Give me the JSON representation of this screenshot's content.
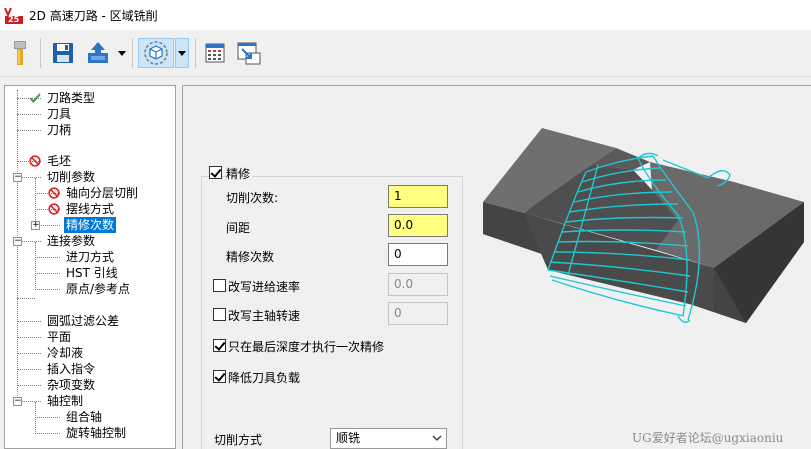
{
  "window": {
    "title": "2D 高速刀路 - 区域铣削",
    "logo_text": "25",
    "colors": {
      "logo_red": "#cc1f1f",
      "selection_blue": "#0078d7",
      "highlight_yellow": "#ffff80",
      "toolpath_cyan": "#1ec8d2"
    }
  },
  "toolbar": {
    "buttons": [
      {
        "name": "tool-icon"
      },
      {
        "name": "save-icon"
      },
      {
        "name": "export-icon"
      },
      {
        "name": "view-cube-icon",
        "active": true
      },
      {
        "name": "calculator-icon"
      },
      {
        "name": "minimize-to-graphics-icon"
      }
    ]
  },
  "tree": {
    "items": [
      {
        "label": "刀路类型",
        "mark": "check"
      },
      {
        "label": "刀具"
      },
      {
        "label": "刀柄"
      },
      {
        "label": "毛坯",
        "mark": "forbidden"
      },
      {
        "label": "切削参数",
        "expander": "−"
      },
      {
        "label": "轴向分层切削",
        "mark": "forbidden"
      },
      {
        "label": "摆线方式",
        "mark": "forbidden"
      },
      {
        "label": "精修次数",
        "expander": "+",
        "selected": true
      },
      {
        "label": "连接参数",
        "expander": "−"
      },
      {
        "label": "进刀方式"
      },
      {
        "label": "HST 引线"
      },
      {
        "label": "原点/参考点"
      },
      {
        "label": "圆弧过滤公差"
      },
      {
        "label": "平面"
      },
      {
        "label": "冷却液"
      },
      {
        "label": "插入指令"
      },
      {
        "label": "杂项变数"
      },
      {
        "label": "轴控制",
        "expander": "−"
      },
      {
        "label": "组合轴"
      },
      {
        "label": "旋转轴控制"
      }
    ]
  },
  "form": {
    "finish": {
      "label": "精修",
      "checked": true
    },
    "cut_count": {
      "label": "切削次数:",
      "value": "1"
    },
    "spacing": {
      "label": "间距",
      "value": "0.0"
    },
    "finish_count": {
      "label": "精修次数",
      "value": "0"
    },
    "override_feed": {
      "label": "改写进给速率",
      "checked": false,
      "value": "0.0"
    },
    "override_spindle": {
      "label": "改写主轴转速",
      "checked": false,
      "value": "0"
    },
    "final_depth_only": {
      "label": "只在最后深度才执行一次精修",
      "checked": true
    },
    "reduce_load": {
      "label": "降低刀具负载",
      "checked": true
    },
    "cut_method": {
      "label": "切削方式",
      "value": "顺铣"
    }
  },
  "watermark": "UG爱好者论坛@ugxiaoniu"
}
